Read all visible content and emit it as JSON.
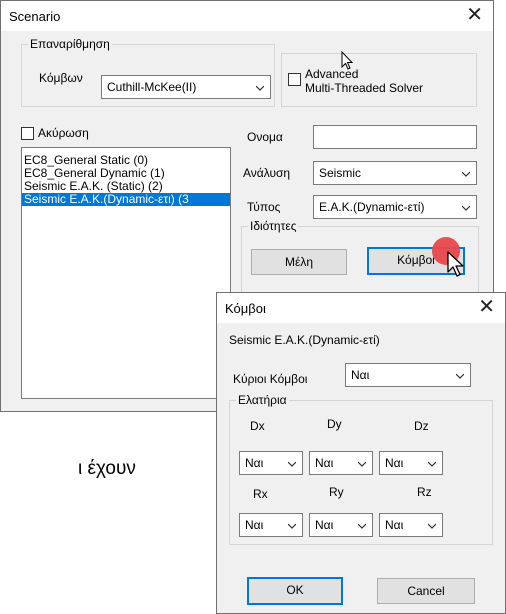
{
  "scenario": {
    "title": "Scenario",
    "renumbering": {
      "legend": "Επαναρίθμηση",
      "nodes_label": "Κόμβων",
      "method": "Cuthill-McKee(II)"
    },
    "solver": {
      "label_line1": "Advanced",
      "label_line2": "Multi-Threaded Solver"
    },
    "cancel_check": "Ακύρωση",
    "list_items": [
      "EC8_General Static (0)",
      "EC8_General Dynamic (1)",
      "Seismic E.A.K. (Static) (2)",
      "Seismic E.A.K.(Dynamic-ετι) (3"
    ],
    "name_label": "Ονομα",
    "name_value": "",
    "analysis_label": "Ανάλυση",
    "analysis_value": "Seismic",
    "type_label": "Τύπος",
    "type_value": "E.A.K.(Dynamic-ετί)",
    "props_legend": "Ιδιότητες",
    "members_btn": "Μέλη",
    "nodes_btn": "Κόμβοι"
  },
  "background_text": "ι έχουν",
  "nodes_dialog": {
    "title": "Κόμβοι",
    "heading": "Seismic E.A.K.(Dynamic-ετί)",
    "main_nodes_label": "Κύριοι Κόμβοι",
    "main_nodes_value": "Ναι",
    "springs_legend": "Ελατήρια",
    "row1_labels": [
      "Dx",
      "Dy",
      "Dz"
    ],
    "row1_values": [
      "Ναι",
      "Ναι",
      "Ναι"
    ],
    "row2_labels": [
      "Rx",
      "Ry",
      "Rz"
    ],
    "row2_values": [
      "Ναι",
      "Ναι",
      "Ναι"
    ],
    "ok": "OK",
    "cancel": "Cancel"
  },
  "colors": {
    "selection": "#0078d7",
    "cursor_dot": "#e8474b",
    "focus_border": "#0078d7"
  }
}
